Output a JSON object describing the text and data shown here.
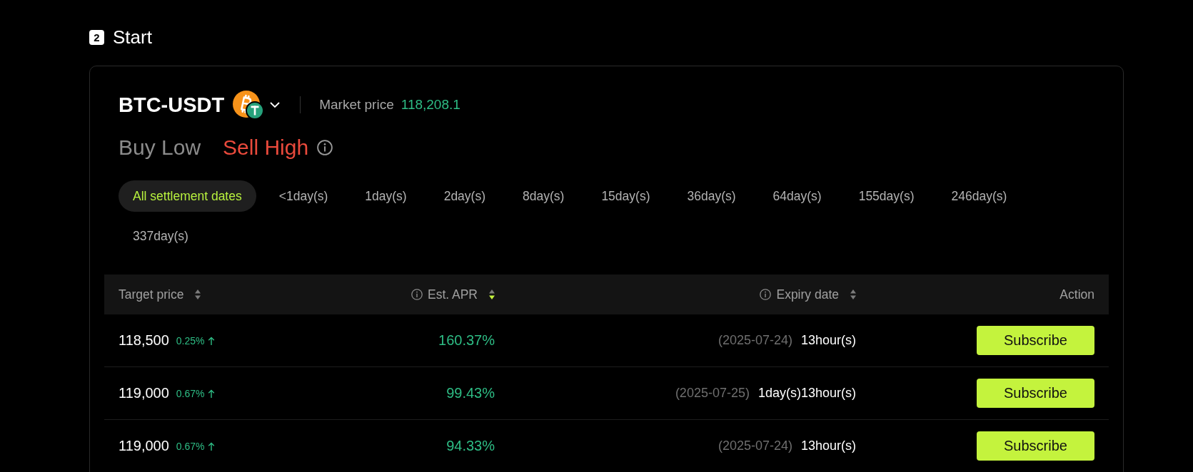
{
  "step": {
    "number": "2",
    "title": "Start"
  },
  "pair": {
    "symbol": "BTC-USDT",
    "price_label": "Market price",
    "price": "118,208.1"
  },
  "modes": [
    {
      "label": "Buy Low",
      "selected": false
    },
    {
      "label": "Sell High",
      "selected": true
    }
  ],
  "date_filters": [
    {
      "label": "All settlement dates",
      "selected": true
    },
    {
      "label": "<1day(s)",
      "selected": false
    },
    {
      "label": "1day(s)",
      "selected": false
    },
    {
      "label": "2day(s)",
      "selected": false
    },
    {
      "label": "8day(s)",
      "selected": false
    },
    {
      "label": "15day(s)",
      "selected": false
    },
    {
      "label": "36day(s)",
      "selected": false
    },
    {
      "label": "64day(s)",
      "selected": false
    },
    {
      "label": "155day(s)",
      "selected": false
    },
    {
      "label": "246day(s)",
      "selected": false
    },
    {
      "label": "337day(s)",
      "selected": false
    }
  ],
  "table": {
    "columns": [
      {
        "label": "Target price",
        "info": false,
        "sortable": true,
        "sorted_descending": false
      },
      {
        "label": "Est. APR",
        "info": true,
        "sortable": true,
        "sorted_descending": true
      },
      {
        "label": "Expiry date",
        "info": true,
        "sortable": true,
        "sorted_descending": false
      },
      {
        "label": "Action",
        "info": false,
        "sortable": false
      }
    ],
    "rows": [
      {
        "target_price": "118,500",
        "change": "0.25%",
        "rising": true,
        "apr": "160.37%",
        "expiry_date": "(2025-07-24)",
        "time_left": "13hour(s)",
        "action": "Subscribe"
      },
      {
        "target_price": "119,000",
        "change": "0.67%",
        "rising": true,
        "apr": "99.43%",
        "expiry_date": "(2025-07-25)",
        "time_left": "1day(s)13hour(s)",
        "action": "Subscribe"
      },
      {
        "target_price": "119,000",
        "change": "0.67%",
        "rising": true,
        "apr": "94.33%",
        "expiry_date": "(2025-07-24)",
        "time_left": "13hour(s)",
        "action": "Subscribe"
      }
    ]
  }
}
